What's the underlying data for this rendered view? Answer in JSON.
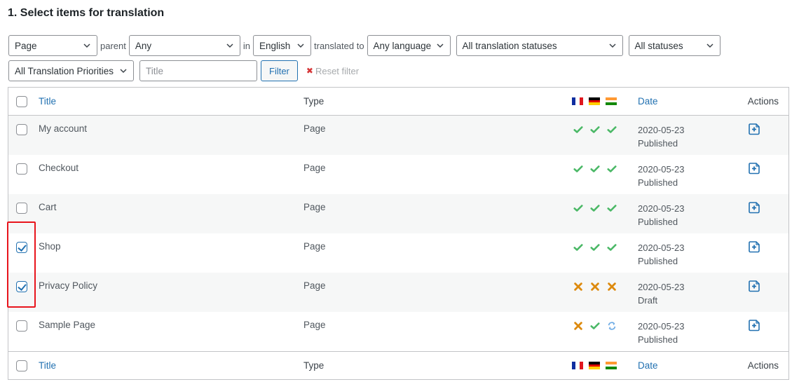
{
  "heading": "1. Select items for translation",
  "filters": {
    "type_select": "Page",
    "parent_label": "parent",
    "parent_select": "Any",
    "in_label": "in",
    "language_select": "English",
    "translated_to_label": "translated to",
    "target_language_select": "Any language",
    "translation_status_select": "All translation statuses",
    "status_select": "All statuses",
    "priority_select": "All Translation Priorities",
    "title_placeholder": "Title",
    "filter_button": "Filter",
    "reset_filter": "Reset filter"
  },
  "table": {
    "headers": {
      "title": "Title",
      "type": "Type",
      "languages": [
        "fr",
        "de",
        "in"
      ],
      "date": "Date",
      "actions": "Actions"
    },
    "rows": [
      {
        "title": "My account",
        "type": "Page",
        "checked": false,
        "statuses": [
          "translated",
          "translated",
          "translated"
        ],
        "date": "2020-05-23",
        "status": "Published"
      },
      {
        "title": "Checkout",
        "type": "Page",
        "checked": false,
        "statuses": [
          "translated",
          "translated",
          "translated"
        ],
        "date": "2020-05-23",
        "status": "Published"
      },
      {
        "title": "Cart",
        "type": "Page",
        "checked": false,
        "statuses": [
          "translated",
          "translated",
          "translated"
        ],
        "date": "2020-05-23",
        "status": "Published"
      },
      {
        "title": "Shop",
        "type": "Page",
        "checked": true,
        "statuses": [
          "translated",
          "translated",
          "translated"
        ],
        "date": "2020-05-23",
        "status": "Published"
      },
      {
        "title": "Privacy Policy",
        "type": "Page",
        "checked": true,
        "statuses": [
          "not-translated",
          "not-translated",
          "not-translated"
        ],
        "date": "2020-05-23",
        "status": "Draft"
      },
      {
        "title": "Sample Page",
        "type": "Page",
        "checked": false,
        "statuses": [
          "not-translated",
          "translated",
          "in-progress"
        ],
        "date": "2020-05-23",
        "status": "Published"
      }
    ]
  },
  "colors": {
    "link": "#2271b1",
    "check": "#4ab866",
    "cross": "#dd8a0e",
    "sync": "#72aee6",
    "highlight": "#e8141c"
  }
}
